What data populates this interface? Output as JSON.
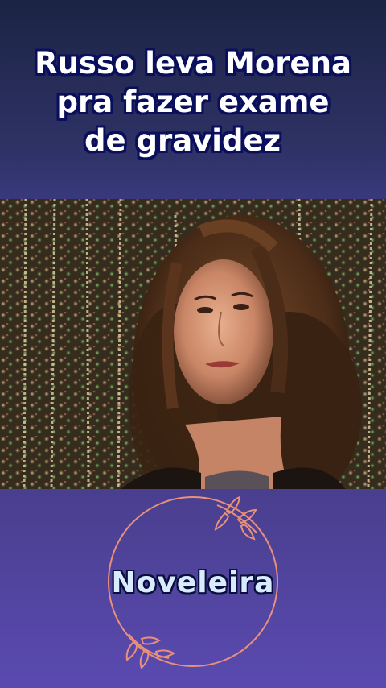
{
  "title": {
    "line1": "Russo leva Morena",
    "line2": "pra fazer exame",
    "line3": "de gravidez"
  },
  "video": {
    "icon": "video-still"
  },
  "logo": {
    "text": "Noveleira",
    "icon": "sun-icon",
    "accent": "#e8907a"
  },
  "colors": {
    "title_outline": "#0a0f5c",
    "background_top": "#1b2444",
    "background_bottom": "#5a4ab0"
  }
}
